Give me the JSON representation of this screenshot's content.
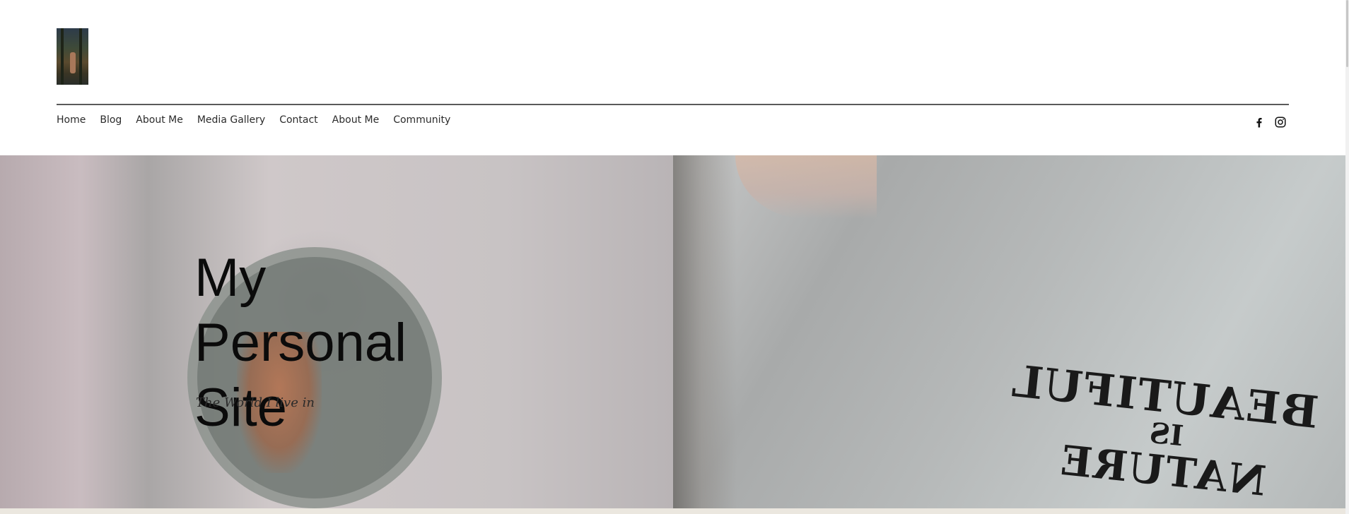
{
  "header": {
    "logo_name": "site-logo"
  },
  "nav": {
    "items": [
      {
        "label": "Home"
      },
      {
        "label": "Blog"
      },
      {
        "label": "About Me"
      },
      {
        "label": "Media Gallery"
      },
      {
        "label": "Contact"
      },
      {
        "label": "About Me"
      },
      {
        "label": "Community"
      }
    ]
  },
  "social": {
    "icons": [
      "facebook-icon",
      "instagram-icon"
    ]
  },
  "hero": {
    "title": "My Personal Site",
    "subtitle": "The World I live in",
    "shirt_print": [
      "BEAUTIFUL",
      "IS",
      "NATURE"
    ]
  },
  "colors": {
    "text": "#111111",
    "rule": "#5a5a5a",
    "footer_strip": "#ebe7df"
  }
}
